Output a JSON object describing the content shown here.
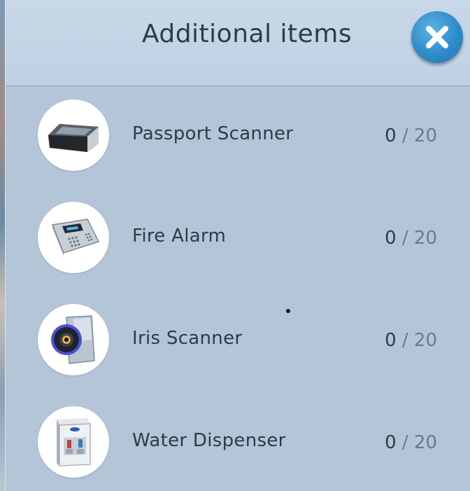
{
  "header": {
    "title": "Additional items",
    "close_icon": "close-icon"
  },
  "items": [
    {
      "label": "Passport Scanner",
      "count": "0",
      "separator": "/",
      "max": "20",
      "icon": "passport-scanner-icon"
    },
    {
      "label": "Fire Alarm",
      "count": "0",
      "separator": "/",
      "max": "20",
      "icon": "fire-alarm-icon"
    },
    {
      "label": "Iris Scanner",
      "count": "0",
      "separator": "/",
      "max": "20",
      "icon": "iris-scanner-icon"
    },
    {
      "label": "Water Dispenser",
      "count": "0",
      "separator": "/",
      "max": "20",
      "icon": "water-dispenser-icon"
    }
  ],
  "colors": {
    "panel": "#b3c5d6",
    "header": "#c8d8e8",
    "close_button": "#2f8cc8",
    "text": "#2e3b48"
  }
}
